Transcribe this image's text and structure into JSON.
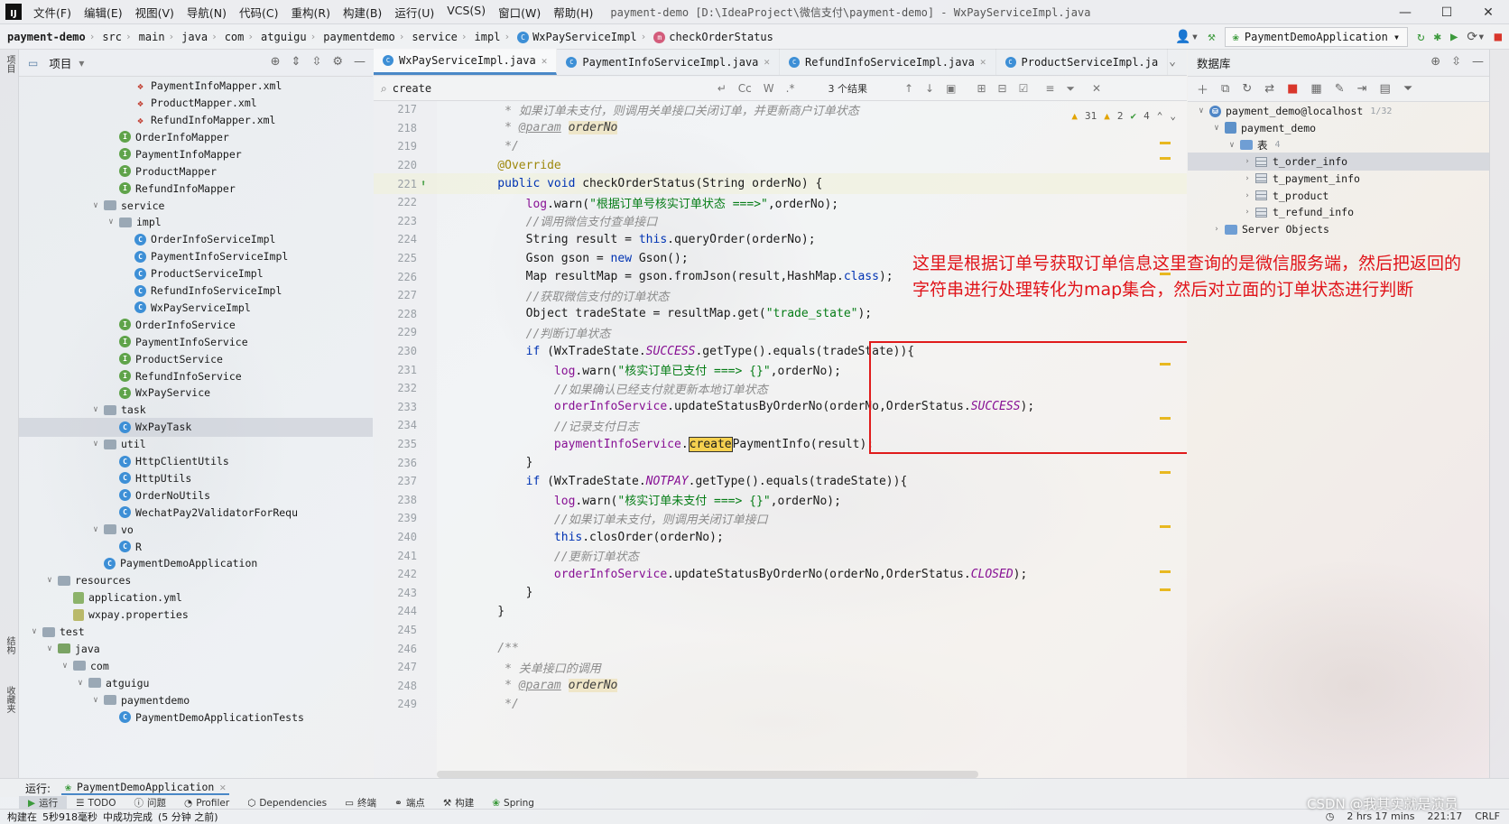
{
  "app": {
    "window_title": "payment-demo [D:\\IdeaProject\\微信支付\\payment-demo] - WxPayServiceImpl.java",
    "menu": [
      "文件(F)",
      "编辑(E)",
      "视图(V)",
      "导航(N)",
      "代码(C)",
      "重构(R)",
      "构建(B)",
      "运行(U)",
      "VCS(S)",
      "窗口(W)",
      "帮助(H)"
    ],
    "window_controls": [
      "—",
      "☐",
      "✕"
    ]
  },
  "breadcrumb": {
    "items": [
      "payment-demo",
      "src",
      "main",
      "java",
      "com",
      "atguigu",
      "paymentdemo",
      "service",
      "impl",
      "WxPayServiceImpl",
      "checkOrderStatus"
    ],
    "run_config": "PaymentDemoApplication"
  },
  "project_panel": {
    "title": "项目",
    "stripe_labels": [
      "项目",
      "结构",
      "收藏夹"
    ],
    "tree": [
      {
        "label": "PaymentInfoMapper.xml",
        "icon": "xml",
        "indent": 9,
        "arrow": ""
      },
      {
        "label": "ProductMapper.xml",
        "icon": "xml",
        "indent": 9,
        "arrow": ""
      },
      {
        "label": "RefundInfoMapper.xml",
        "icon": "xml",
        "indent": 9,
        "arrow": ""
      },
      {
        "label": "OrderInfoMapper",
        "icon": "intf",
        "indent": 8,
        "arrow": ""
      },
      {
        "label": "PaymentInfoMapper",
        "icon": "intf",
        "indent": 8,
        "arrow": ""
      },
      {
        "label": "ProductMapper",
        "icon": "intf",
        "indent": 8,
        "arrow": ""
      },
      {
        "label": "RefundInfoMapper",
        "icon": "intf",
        "indent": 8,
        "arrow": ""
      },
      {
        "label": "service",
        "icon": "folder",
        "indent": 7,
        "arrow": "∨"
      },
      {
        "label": "impl",
        "icon": "folder",
        "indent": 8,
        "arrow": "∨"
      },
      {
        "label": "OrderInfoServiceImpl",
        "icon": "cls",
        "indent": 9,
        "arrow": ""
      },
      {
        "label": "PaymentInfoServiceImpl",
        "icon": "cls",
        "indent": 9,
        "arrow": ""
      },
      {
        "label": "ProductServiceImpl",
        "icon": "cls",
        "indent": 9,
        "arrow": ""
      },
      {
        "label": "RefundInfoServiceImpl",
        "icon": "cls",
        "indent": 9,
        "arrow": ""
      },
      {
        "label": "WxPayServiceImpl",
        "icon": "cls",
        "indent": 9,
        "arrow": ""
      },
      {
        "label": "OrderInfoService",
        "icon": "intf",
        "indent": 8,
        "arrow": ""
      },
      {
        "label": "PaymentInfoService",
        "icon": "intf",
        "indent": 8,
        "arrow": ""
      },
      {
        "label": "ProductService",
        "icon": "intf",
        "indent": 8,
        "arrow": ""
      },
      {
        "label": "RefundInfoService",
        "icon": "intf",
        "indent": 8,
        "arrow": ""
      },
      {
        "label": "WxPayService",
        "icon": "intf",
        "indent": 8,
        "arrow": ""
      },
      {
        "label": "task",
        "icon": "folder",
        "indent": 7,
        "arrow": "∨"
      },
      {
        "label": "WxPayTask",
        "icon": "cls",
        "indent": 8,
        "arrow": "",
        "selected": true
      },
      {
        "label": "util",
        "icon": "folder",
        "indent": 7,
        "arrow": "∨"
      },
      {
        "label": "HttpClientUtils",
        "icon": "cls",
        "indent": 8,
        "arrow": ""
      },
      {
        "label": "HttpUtils",
        "icon": "cls",
        "indent": 8,
        "arrow": ""
      },
      {
        "label": "OrderNoUtils",
        "icon": "cls",
        "indent": 8,
        "arrow": ""
      },
      {
        "label": "WechatPay2ValidatorForRequ",
        "icon": "cls",
        "indent": 8,
        "arrow": ""
      },
      {
        "label": "vo",
        "icon": "folder",
        "indent": 7,
        "arrow": "∨"
      },
      {
        "label": "R",
        "icon": "cls",
        "indent": 8,
        "arrow": ""
      },
      {
        "label": "PaymentDemoApplication",
        "icon": "app",
        "indent": 7,
        "arrow": ""
      },
      {
        "label": "resources",
        "icon": "folder",
        "indent": 4,
        "arrow": "∨"
      },
      {
        "label": "application.yml",
        "icon": "yml",
        "indent": 5,
        "arrow": ""
      },
      {
        "label": "wxpay.properties",
        "icon": "props",
        "indent": 5,
        "arrow": ""
      },
      {
        "label": "test",
        "icon": "folder",
        "indent": 3,
        "arrow": "∨"
      },
      {
        "label": "java",
        "icon": "folder-green",
        "indent": 4,
        "arrow": "∨"
      },
      {
        "label": "com",
        "icon": "folder",
        "indent": 5,
        "arrow": "∨"
      },
      {
        "label": "atguigu",
        "icon": "folder",
        "indent": 6,
        "arrow": "∨"
      },
      {
        "label": "paymentdemo",
        "icon": "folder",
        "indent": 7,
        "arrow": "∨"
      },
      {
        "label": "PaymentDemoApplicationTests",
        "icon": "cls",
        "indent": 8,
        "arrow": ""
      }
    ]
  },
  "editor": {
    "tabs": [
      {
        "label": "WxPayServiceImpl.java",
        "active": true
      },
      {
        "label": "PaymentInfoServiceImpl.java",
        "active": false
      },
      {
        "label": "RefundInfoServiceImpl.java",
        "active": false
      },
      {
        "label": "ProductServiceImpl.ja",
        "active": false
      }
    ],
    "search": {
      "value": "create",
      "result_count": "3 个结果"
    },
    "inspections": {
      "warnings": "31",
      "weak_warnings": "2",
      "ok": "4"
    },
    "lines": [
      {
        "n": "217",
        "segs": [
          [
            "cmt",
            "     * 如果订单未支付，则调用关单接口关闭订单，并更新商户订单状态"
          ]
        ]
      },
      {
        "n": "218",
        "segs": [
          [
            "cmt",
            "     * "
          ],
          [
            "javadoc-tag",
            "@param"
          ],
          [
            "cmt",
            " "
          ],
          [
            "param",
            "orderNo"
          ]
        ]
      },
      {
        "n": "219",
        "segs": [
          [
            "cmt",
            "     */"
          ]
        ]
      },
      {
        "n": "220",
        "segs": [
          [
            "ann",
            "    @Override"
          ]
        ]
      },
      {
        "n": "221",
        "segs": [
          [
            "kw",
            "    public void "
          ],
          [
            "",
            "checkOrderStatus(String orderNo) {"
          ]
        ],
        "current": true
      },
      {
        "n": "222",
        "segs": [
          [
            "fld",
            "        log"
          ],
          [
            "",
            ".warn("
          ],
          [
            "str",
            "\"根据订单号核实订单状态 ===>\""
          ],
          [
            "",
            ",orderNo);"
          ]
        ]
      },
      {
        "n": "223",
        "segs": [
          [
            "cmt",
            "        //调用微信支付查单接口"
          ]
        ]
      },
      {
        "n": "224",
        "segs": [
          [
            "",
            "        String result = "
          ],
          [
            "kw",
            "this"
          ],
          [
            "",
            ".queryOrder(orderNo);"
          ]
        ]
      },
      {
        "n": "225",
        "segs": [
          [
            "",
            "        Gson gson = "
          ],
          [
            "kw",
            "new "
          ],
          [
            "",
            "Gson();"
          ]
        ]
      },
      {
        "n": "226",
        "segs": [
          [
            "",
            "        Map resultMap = gson.fromJson(result,HashMap."
          ],
          [
            "kw",
            "class"
          ],
          [
            "",
            ");"
          ]
        ]
      },
      {
        "n": "227",
        "segs": [
          [
            "cmt",
            "        //获取微信支付的订单状态"
          ]
        ]
      },
      {
        "n": "228",
        "segs": [
          [
            "",
            "        Object tradeState = resultMap.get("
          ],
          [
            "str",
            "\"trade_state\""
          ],
          [
            "",
            ");"
          ]
        ]
      },
      {
        "n": "229",
        "segs": [
          [
            "cmt",
            "        //判断订单状态"
          ]
        ]
      },
      {
        "n": "230",
        "segs": [
          [
            "kw",
            "        if "
          ],
          [
            "",
            "(WxTradeState."
          ],
          [
            "fld it",
            "SUCCESS"
          ],
          [
            "",
            ".getType().equals(tradeState)){"
          ]
        ]
      },
      {
        "n": "231",
        "segs": [
          [
            "fld",
            "            log"
          ],
          [
            "",
            ".warn("
          ],
          [
            "str",
            "\"核实订单已支付 ===> {}\""
          ],
          [
            "",
            ",orderNo);"
          ]
        ]
      },
      {
        "n": "232",
        "segs": [
          [
            "cmt",
            "            //如果确认已经支付就更新本地订单状态"
          ]
        ]
      },
      {
        "n": "233",
        "segs": [
          [
            "fld",
            "            orderInfoService"
          ],
          [
            "",
            ".updateStatusByOrderNo(orderNo,OrderStatus."
          ],
          [
            "fld it",
            "SUCCESS"
          ],
          [
            "",
            ");"
          ]
        ]
      },
      {
        "n": "234",
        "segs": [
          [
            "cmt",
            "            //记录支付日志"
          ]
        ]
      },
      {
        "n": "235",
        "segs": [
          [
            "fld",
            "            paymentInfoService"
          ],
          [
            "",
            "."
          ],
          [
            "hl",
            "create"
          ],
          [
            "",
            "PaymentInfo(result);"
          ]
        ]
      },
      {
        "n": "236",
        "segs": [
          [
            "",
            "        }"
          ]
        ]
      },
      {
        "n": "237",
        "segs": [
          [
            "kw",
            "        if "
          ],
          [
            "",
            "(WxTradeState."
          ],
          [
            "fld it",
            "NOTPAY"
          ],
          [
            "",
            ".getType().equals(tradeState)){"
          ]
        ]
      },
      {
        "n": "238",
        "segs": [
          [
            "fld",
            "            log"
          ],
          [
            "",
            ".warn("
          ],
          [
            "str",
            "\"核实订单未支付 ===> {}\""
          ],
          [
            "",
            ",orderNo);"
          ]
        ]
      },
      {
        "n": "239",
        "segs": [
          [
            "cmt",
            "            //如果订单未支付，则调用关闭订单接口"
          ]
        ]
      },
      {
        "n": "240",
        "segs": [
          [
            "kw",
            "            this"
          ],
          [
            "",
            ".closOrder(orderNo);"
          ]
        ]
      },
      {
        "n": "241",
        "segs": [
          [
            "cmt",
            "            //更新订单状态"
          ]
        ]
      },
      {
        "n": "242",
        "segs": [
          [
            "fld",
            "            orderInfoService"
          ],
          [
            "",
            ".updateStatusByOrderNo(orderNo,OrderStatus."
          ],
          [
            "fld it",
            "CLOSED"
          ],
          [
            "",
            ");"
          ]
        ]
      },
      {
        "n": "243",
        "segs": [
          [
            "",
            "        }"
          ]
        ]
      },
      {
        "n": "244",
        "segs": [
          [
            "",
            "    }"
          ]
        ]
      },
      {
        "n": "245",
        "segs": [
          [
            "",
            ""
          ]
        ]
      },
      {
        "n": "246",
        "segs": [
          [
            "cmt",
            "    /**"
          ]
        ]
      },
      {
        "n": "247",
        "segs": [
          [
            "cmt",
            "     * 关单接口的调用"
          ]
        ]
      },
      {
        "n": "248",
        "segs": [
          [
            "cmt",
            "     * "
          ],
          [
            "javadoc-tag",
            "@param"
          ],
          [
            "cmt",
            " "
          ],
          [
            "param",
            "orderNo"
          ]
        ]
      },
      {
        "n": "249",
        "segs": [
          [
            "cmt",
            "     */"
          ]
        ]
      }
    ]
  },
  "annotation": {
    "text_line1": "这里是根据订单号获取订单信息这里查询的是微信服务端，然后把返回的",
    "text_line2": "字符串进行处理转化为map集合，然后对立面的订单状态进行判断",
    "color": "#e0141a"
  },
  "database_panel": {
    "title": "数据库",
    "tree": [
      {
        "label": "payment_demo@localhost",
        "badge": "1/32",
        "indent": 1,
        "arrow": "∨",
        "kind": "host"
      },
      {
        "label": "payment_demo",
        "badge": "",
        "indent": 2,
        "arrow": "∨",
        "kind": "schema"
      },
      {
        "label": "表",
        "badge": "4",
        "indent": 3,
        "arrow": "∨",
        "kind": "folder"
      },
      {
        "label": "t_order_info",
        "badge": "",
        "indent": 4,
        "arrow": "›",
        "kind": "table",
        "selected": true
      },
      {
        "label": "t_payment_info",
        "badge": "",
        "indent": 4,
        "arrow": "›",
        "kind": "table"
      },
      {
        "label": "t_product",
        "badge": "",
        "indent": 4,
        "arrow": "›",
        "kind": "table"
      },
      {
        "label": "t_refund_info",
        "badge": "",
        "indent": 4,
        "arrow": "›",
        "kind": "table"
      },
      {
        "label": "Server Objects",
        "badge": "",
        "indent": 2,
        "arrow": "›",
        "kind": "folder"
      }
    ]
  },
  "bottom": {
    "run_label": "运行:",
    "run_config": "PaymentDemoApplication",
    "tool_windows": [
      "运行",
      "TODO",
      "问题",
      "Profiler",
      "Dependencies",
      "终端",
      "端点",
      "构建",
      "Spring"
    ],
    "status_text": [
      "构建在",
      "5秒918毫秒",
      "中成功完成",
      "(5 分钟 之前)"
    ],
    "status_right": [
      "2 hrs 17 mins",
      "221:17",
      "CRLF"
    ],
    "watermark": "CSDN @我其实就是演员"
  }
}
